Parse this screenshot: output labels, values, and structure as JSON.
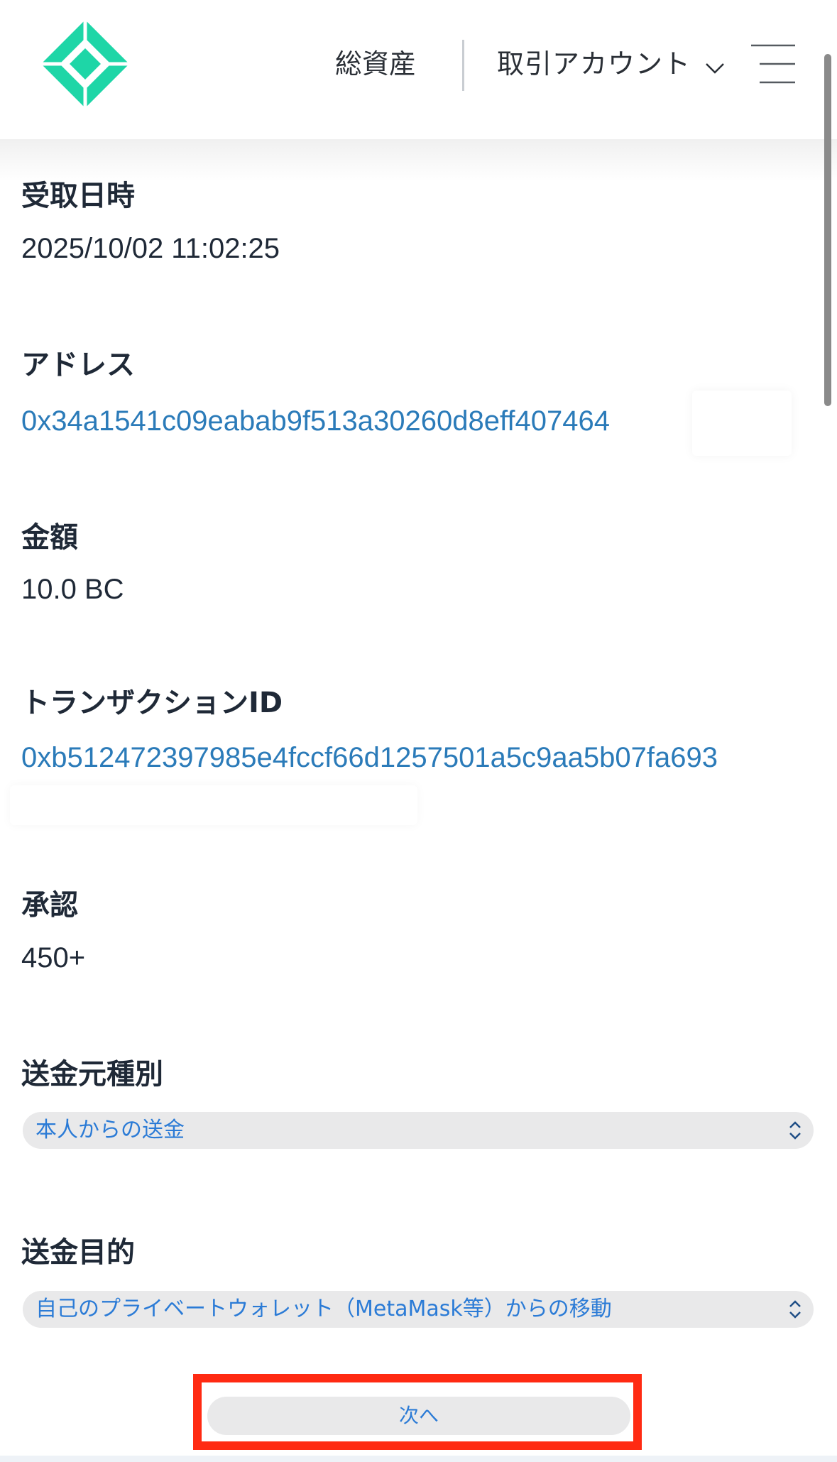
{
  "header": {
    "logo_name": "diamond-logo",
    "nav_total_label": "総資産",
    "nav_account_label": "取引アカウント",
    "brand_color": "#1ed6a7"
  },
  "details": {
    "received_at": {
      "label": "受取日時",
      "value": "2025/10/02 11:02:25"
    },
    "address": {
      "label": "アドレス",
      "value": "0x34a1541c09eabab9f513a30260d8eff407464"
    },
    "amount": {
      "label": "金額",
      "value": "10.0 BC"
    },
    "transaction": {
      "label": "トランザクションID",
      "value": "0xb512472397985e4fccf66d1257501a5c9aa5b07fa693"
    },
    "confirmations": {
      "label": "承認",
      "value": "450+"
    }
  },
  "form": {
    "source_type": {
      "label": "送金元種別",
      "selected": "本人からの送金"
    },
    "purpose": {
      "label": "送金目的",
      "selected": "自己のプライベートウォレット（MetaMask等）からの移動"
    },
    "next_button_label": "次へ"
  },
  "colors": {
    "link": "#2b7bb9",
    "select_text": "#2b7bd6",
    "highlight": "#ff2a12"
  }
}
